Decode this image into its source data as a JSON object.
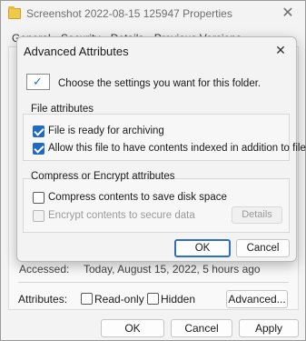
{
  "props_window": {
    "title": "Screenshot 2022-08-15 125947 Properties",
    "close_glyph": "✕",
    "tabs": [
      "General",
      "Security",
      "Details",
      "Previous Versions"
    ],
    "accessed_label": "Accessed:",
    "accessed_value": "Today, August 15, 2022, 5 hours ago",
    "attributes_label": "Attributes:",
    "readonly_label": "Read-only",
    "hidden_label": "Hidden",
    "advanced_button": "Advanced...",
    "ok_button": "OK",
    "cancel_button": "Cancel",
    "apply_button": "Apply",
    "readonly_checked": false,
    "hidden_checked": false
  },
  "advanced_dialog": {
    "title": "Advanced Attributes",
    "close_glyph": "✕",
    "instruction": "Choose the settings you want for this folder.",
    "file_attributes_title": "File attributes",
    "archive_label": "File is ready for archiving",
    "index_label": "Allow this file to have contents indexed in addition to file",
    "compress_encrypt_title": "Compress or Encrypt attributes",
    "compress_label": "Compress contents to save disk space",
    "encrypt_label": "Encrypt contents to secure data",
    "details_button": "Details",
    "ok_button": "OK",
    "cancel_button": "Cancel",
    "archive_checked": true,
    "index_checked": true,
    "compress_checked": false,
    "encrypt_checked": false
  },
  "colors": {
    "accent": "#1f6bbf",
    "window_bg": "#f3f3f3",
    "disabled_text": "#9a9a9a"
  },
  "icons": {
    "app": "folder-icon",
    "check": "✓"
  }
}
